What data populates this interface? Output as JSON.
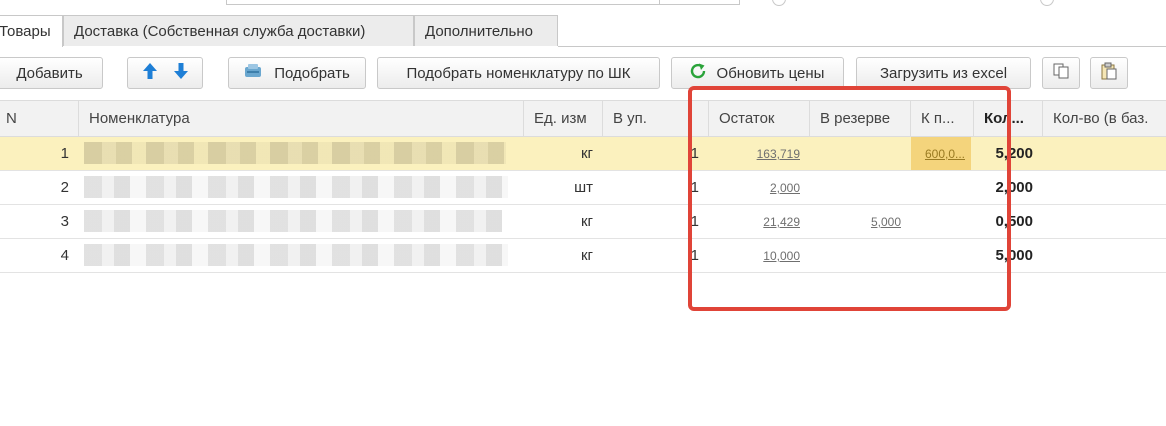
{
  "tabs": [
    {
      "label": "Товары",
      "active": true
    },
    {
      "label": "Доставка (Собственная служба доставки)",
      "active": false
    },
    {
      "label": "Дополнительно",
      "active": false
    }
  ],
  "toolbar": {
    "add_label": "Добавить",
    "pick_label": "Подобрать",
    "pick_barcode_label": "Подобрать номенклатуру по ШК",
    "refresh_prices_label": "Обновить цены",
    "load_excel_label": "Загрузить из excel"
  },
  "table": {
    "columns": [
      "N",
      "Номенклатура",
      "Ед. изм",
      "В уп.",
      "Остаток",
      "В резерве",
      "К п...",
      "Кол...",
      "Кол-во (в баз."
    ],
    "rows": [
      {
        "n": "1",
        "unit": "кг",
        "pack": "1",
        "stock": "163,719",
        "reserve": "",
        "to_order": "600,0...",
        "qty": "5,200",
        "selected": true
      },
      {
        "n": "2",
        "unit": "шт",
        "pack": "1",
        "stock": "2,000",
        "reserve": "",
        "to_order": "",
        "qty": "2,000",
        "selected": false
      },
      {
        "n": "3",
        "unit": "кг",
        "pack": "1",
        "stock": "21,429",
        "reserve": "5,000",
        "to_order": "",
        "qty": "0,500",
        "selected": false
      },
      {
        "n": "4",
        "unit": "кг",
        "pack": "1",
        "stock": "10,000",
        "reserve": "",
        "to_order": "",
        "qty": "5,000",
        "selected": false
      }
    ]
  },
  "colors": {
    "highlight_box": "#e04438",
    "selected_row": "#fbf1be",
    "accent_blue": "#1e7fd6",
    "refresh_green": "#2aa33a"
  },
  "icons": [
    "arrow-up-icon",
    "arrow-down-icon",
    "pick-icon",
    "refresh-icon",
    "copy-icon",
    "paste-icon"
  ]
}
